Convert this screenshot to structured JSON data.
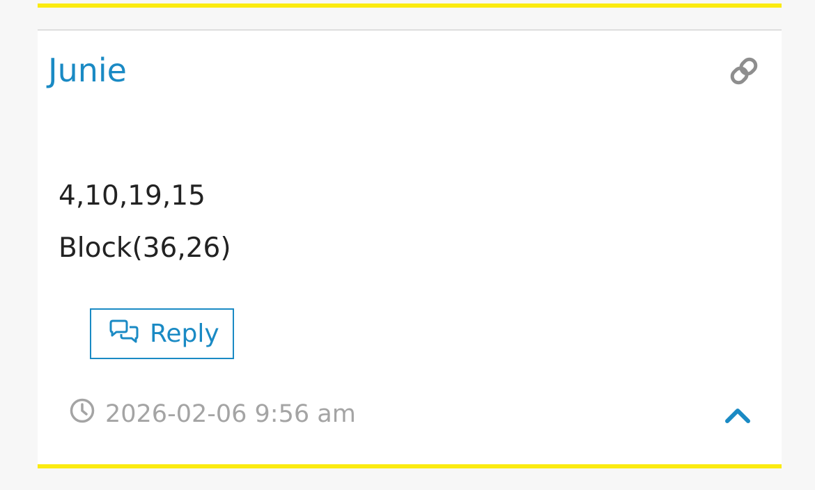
{
  "comment": {
    "author": "Junie",
    "lines": [
      "4,10,19,15",
      "Block(36,26)"
    ],
    "reply_label": "Reply",
    "timestamp": "2026-02-06 9:56 am"
  },
  "icons": {
    "permalink": "link-icon",
    "reply": "comments-icon",
    "timestamp": "clock-icon",
    "scroll_top": "chevron-up-icon"
  },
  "colors": {
    "accent": "#1a8ac4",
    "highlight_bar": "#fbeb10",
    "muted_text": "#a4a4a4",
    "body_text": "#222222"
  }
}
